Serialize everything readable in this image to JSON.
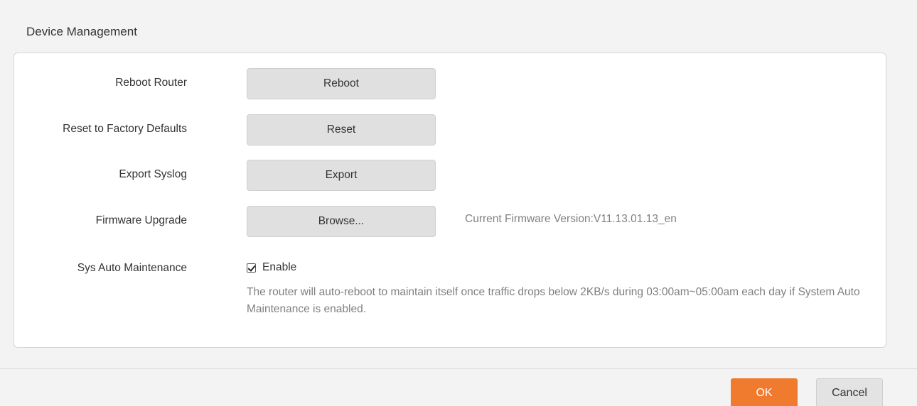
{
  "section": {
    "title": "Device Management"
  },
  "rows": {
    "reboot": {
      "label": "Reboot Router",
      "button": "Reboot"
    },
    "reset": {
      "label": "Reset to Factory Defaults",
      "button": "Reset"
    },
    "export": {
      "label": "Export Syslog",
      "button": "Export"
    },
    "firmware": {
      "label": "Firmware Upgrade",
      "button": "Browse...",
      "version_text": "Current Firmware Version:V11.13.01.13_en"
    },
    "maintenance": {
      "label": "Sys Auto Maintenance",
      "checkbox_label": "Enable",
      "checked": true,
      "description": "The router will auto-reboot to maintain itself once traffic drops below 2KB/s during 03:00am~05:00am each day if System Auto Maintenance is enabled."
    }
  },
  "footer": {
    "ok_label": "OK",
    "cancel_label": "Cancel"
  },
  "colors": {
    "accent": "#f07a2d",
    "page_bg": "#f3f3f3",
    "panel_bg": "#ffffff",
    "button_bg": "#e0e0e0",
    "muted_text": "#808080"
  }
}
